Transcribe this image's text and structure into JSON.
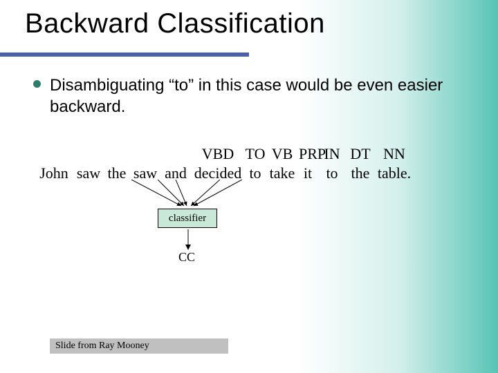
{
  "title": "Backward Classification",
  "bullet": "Disambiguating “to” in this case would be even easier backward.",
  "tags": {
    "john": "",
    "saw1": "",
    "the1": "",
    "saw2": "",
    "and": "",
    "decided": "VBD",
    "to1": "TO",
    "take": "VB",
    "it": "PRP",
    "to2": "IN",
    "the2": "DT",
    "table": "NN"
  },
  "words": {
    "john": "John",
    "saw1": "saw",
    "the1": "the",
    "saw2": "saw",
    "and": "and",
    "decided": "decided",
    "to1": "to",
    "take": "take",
    "it": "it",
    "to2": "to",
    "the2": "the",
    "table": "table."
  },
  "classifier_label": "classifier",
  "result_tag": "CC",
  "attribution": "Slide from Ray Mooney"
}
